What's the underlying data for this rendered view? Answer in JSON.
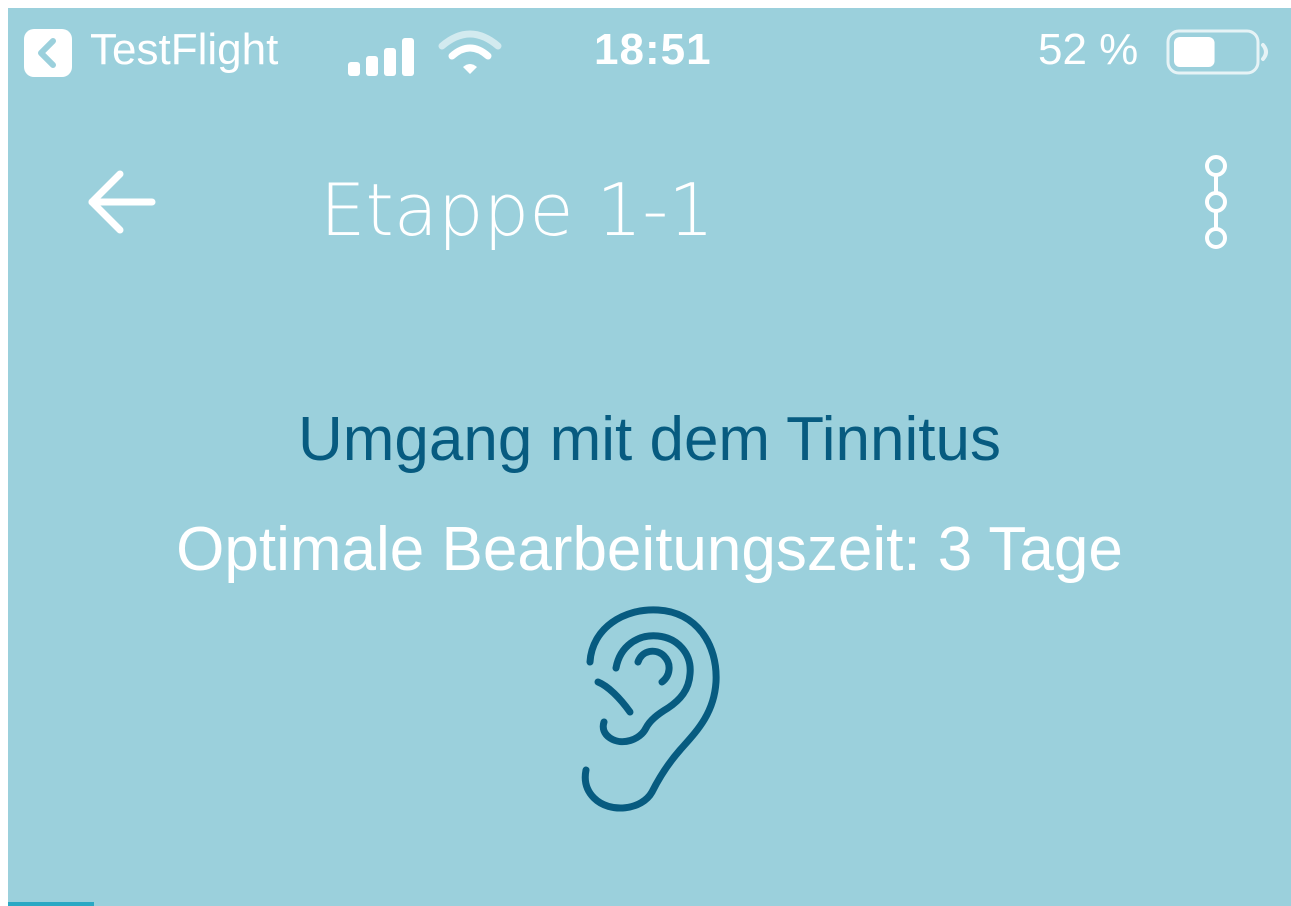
{
  "status_bar": {
    "back_app": "TestFlight",
    "time": "18:51",
    "battery": "52 %",
    "battery_level": 0.52
  },
  "nav": {
    "title": "Etappe 1-1",
    "back_icon": "arrow-left-icon",
    "menu_icon": "stage-path-icon"
  },
  "content": {
    "title": "Umgang mit dem Tinnitus",
    "subtitle": "Optimale Bearbeitungszeit: 3 Tage",
    "icon": "ear-icon"
  },
  "colors": {
    "background": "#9bd0dc",
    "accent": "#075b80",
    "text_light": "#ffffff"
  }
}
